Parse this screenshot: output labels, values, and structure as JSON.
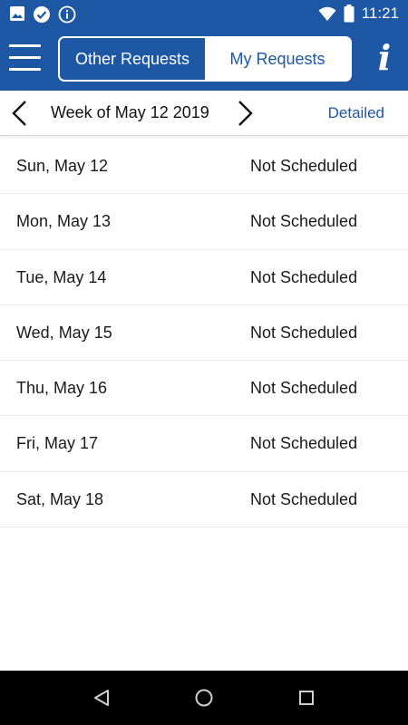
{
  "status_bar": {
    "time": "11:21",
    "left_icons": [
      "image-icon",
      "check-circle-icon",
      "info-circle-icon"
    ],
    "right_icons": [
      "wifi-icon",
      "battery-icon"
    ]
  },
  "header": {
    "tabs": [
      {
        "label": "Other Requests",
        "active": true
      },
      {
        "label": "My Requests",
        "active": false
      }
    ],
    "info_glyph": "i"
  },
  "week_nav": {
    "label": "Week of May 12 2019",
    "detailed_label": "Detailed"
  },
  "days": [
    {
      "date": "Sun, May 12",
      "status": "Not Scheduled"
    },
    {
      "date": "Mon, May 13",
      "status": "Not Scheduled"
    },
    {
      "date": "Tue, May 14",
      "status": "Not Scheduled"
    },
    {
      "date": "Wed, May 15",
      "status": "Not Scheduled"
    },
    {
      "date": "Thu, May 16",
      "status": "Not Scheduled"
    },
    {
      "date": "Fri, May 17",
      "status": "Not Scheduled"
    },
    {
      "date": "Sat, May 18",
      "status": "Not Scheduled"
    }
  ],
  "colors": {
    "brand": "#1e58a5",
    "background": "#ffffff",
    "nav_bar": "#000000"
  }
}
